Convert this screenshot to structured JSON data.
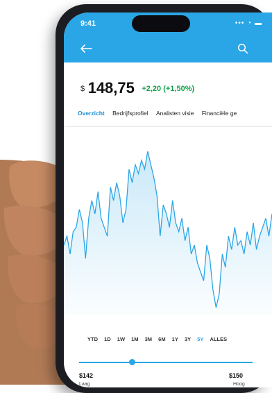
{
  "status": {
    "time": "9:41",
    "icons": "••• ◔ ▬"
  },
  "header": {
    "back_icon": "back-arrow-icon",
    "search_icon": "search-icon"
  },
  "quote": {
    "currency": "$",
    "price": "148,75",
    "change": "+2,20 (+1,50%)"
  },
  "tabs": [
    "Overzicht",
    "Bedrijfsprofiel",
    "Analisten visie",
    "Financiële ge"
  ],
  "ranges": [
    "YTD",
    "1D",
    "1W",
    "1M",
    "3M",
    "6M",
    "1Y",
    "3Y",
    "5Y",
    "ALLES"
  ],
  "active_range": "5Y",
  "colors": {
    "accent": "#2aa6e6",
    "positive": "#14a04a"
  },
  "day_range": {
    "low": "$142",
    "low_label": "Laag",
    "high": "$150",
    "high_label": "Hoog"
  },
  "chart_data": {
    "type": "area",
    "series": [
      {
        "values": [
          150,
          160,
          140,
          165,
          170,
          190,
          175,
          135,
          180,
          200,
          185,
          210,
          180,
          170,
          160,
          215,
          200,
          220,
          205,
          175,
          190,
          235,
          220,
          240,
          230,
          245,
          235,
          255,
          240,
          225,
          205,
          160,
          195,
          185,
          170,
          200,
          175,
          165,
          180,
          155,
          170,
          140,
          150,
          130,
          120,
          110,
          150,
          135,
          100,
          80,
          95,
          140,
          125,
          160,
          145,
          170,
          150,
          155,
          140,
          165,
          150,
          175,
          145,
          160,
          170,
          180,
          160,
          185
        ]
      }
    ]
  }
}
